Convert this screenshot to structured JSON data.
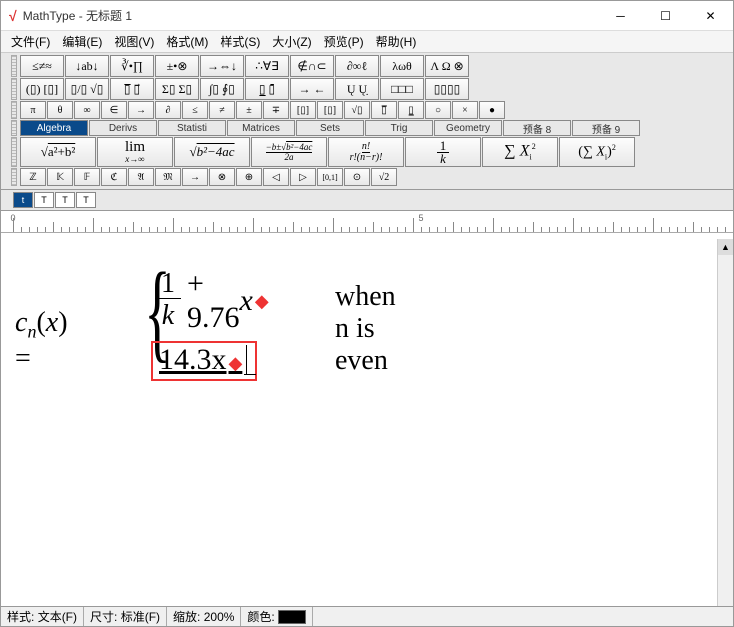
{
  "window": {
    "app": "MathType",
    "title": "MathType - 无标题 1"
  },
  "menubar": [
    "文件(F)",
    "编辑(E)",
    "视图(V)",
    "格式(M)",
    "样式(S)",
    "大小(Z)",
    "预览(P)",
    "帮助(H)"
  ],
  "palette_row1": [
    "≤≠≈",
    "↓ab↓",
    "∛•∏",
    "±•⊗",
    "→⇔↓",
    "∴∀∃",
    "∉∩⊂",
    "∂∞ℓ",
    "λωθ",
    "Λ Ω ⊗"
  ],
  "palette_row2": [
    "(▯) [▯]",
    "▯/▯ √▯",
    "▯̅ ▯⃗",
    "Σ▯ Σ▯",
    "∫▯ ∮▯",
    "▯̲ ▯̄",
    "→ ←",
    "Ų Ų̣",
    "□□□",
    "▯▯▯▯"
  ],
  "palette_row3": [
    "π",
    "θ",
    "∞",
    "∈",
    "→",
    "∂",
    "≤",
    "≠",
    "±",
    "∓",
    "[▯]",
    "[▯]",
    "√▯",
    "▯̅",
    "▯̲",
    "○",
    "×",
    "●"
  ],
  "tabs": [
    {
      "label": "Algebra",
      "active": true
    },
    {
      "label": "Derivs",
      "active": false
    },
    {
      "label": "Statisti",
      "active": false
    },
    {
      "label": "Matrices",
      "active": false
    },
    {
      "label": "Sets",
      "active": false
    },
    {
      "label": "Trig",
      "active": false
    },
    {
      "label": "Geometry",
      "active": false
    },
    {
      "label": "预备 8",
      "active": false
    },
    {
      "label": "预备 9",
      "active": false
    }
  ],
  "big_buttons": [
    "√(a²+b²)",
    "lim x→∞",
    "√(b²−4ac)",
    "(−b±√(b²−4ac))/2a",
    "n! / r!(n−r)!",
    "1/k",
    "Σ Xᵢ²",
    "(Σ Xᵢ)²"
  ],
  "palette_row5": [
    "ℤ",
    "𝕂",
    "𝔽",
    "ℭ",
    "𝔄",
    "𝔐",
    "→",
    "⊗",
    "⊕",
    "◁",
    "▷",
    "[0,1]",
    "⊙",
    "√2"
  ],
  "small_tabs": [
    "t",
    "T",
    "T",
    "T"
  ],
  "ruler": {
    "zero": "0",
    "five": "5"
  },
  "equation": {
    "lhs": {
      "c": "c",
      "n": "n",
      "openp": "(",
      "x": "x",
      "closep": ") ="
    },
    "row1": {
      "frac_n": "1",
      "frac_d": "k",
      "plus": " + 9.76",
      "x": "x",
      "marker": "◆"
    },
    "condition": "when n is even",
    "row2": {
      "text": "14.3x",
      "marker": "◆"
    }
  },
  "statusbar": {
    "style_lbl": "样式:",
    "style_val": "文本(F)",
    "size_lbl": "尺寸:",
    "size_val": "标准(F)",
    "zoom_lbl": "缩放:",
    "zoom_val": "200%",
    "color_lbl": "颜色:"
  }
}
